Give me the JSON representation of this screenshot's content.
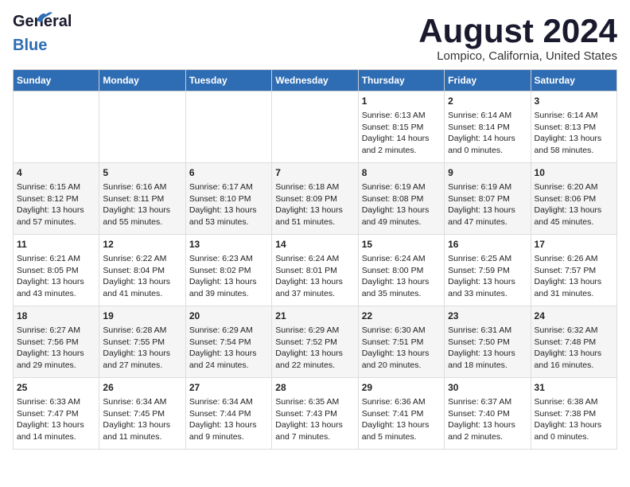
{
  "header": {
    "logo_general": "General",
    "logo_blue": "Blue",
    "title": "August 2024",
    "subtitle": "Lompico, California, United States"
  },
  "days_of_week": [
    "Sunday",
    "Monday",
    "Tuesday",
    "Wednesday",
    "Thursday",
    "Friday",
    "Saturday"
  ],
  "weeks": [
    [
      {
        "day": "",
        "text": ""
      },
      {
        "day": "",
        "text": ""
      },
      {
        "day": "",
        "text": ""
      },
      {
        "day": "",
        "text": ""
      },
      {
        "day": "1",
        "text": "Sunrise: 6:13 AM\nSunset: 8:15 PM\nDaylight: 14 hours\nand 2 minutes."
      },
      {
        "day": "2",
        "text": "Sunrise: 6:14 AM\nSunset: 8:14 PM\nDaylight: 14 hours\nand 0 minutes."
      },
      {
        "day": "3",
        "text": "Sunrise: 6:14 AM\nSunset: 8:13 PM\nDaylight: 13 hours\nand 58 minutes."
      }
    ],
    [
      {
        "day": "4",
        "text": "Sunrise: 6:15 AM\nSunset: 8:12 PM\nDaylight: 13 hours\nand 57 minutes."
      },
      {
        "day": "5",
        "text": "Sunrise: 6:16 AM\nSunset: 8:11 PM\nDaylight: 13 hours\nand 55 minutes."
      },
      {
        "day": "6",
        "text": "Sunrise: 6:17 AM\nSunset: 8:10 PM\nDaylight: 13 hours\nand 53 minutes."
      },
      {
        "day": "7",
        "text": "Sunrise: 6:18 AM\nSunset: 8:09 PM\nDaylight: 13 hours\nand 51 minutes."
      },
      {
        "day": "8",
        "text": "Sunrise: 6:19 AM\nSunset: 8:08 PM\nDaylight: 13 hours\nand 49 minutes."
      },
      {
        "day": "9",
        "text": "Sunrise: 6:19 AM\nSunset: 8:07 PM\nDaylight: 13 hours\nand 47 minutes."
      },
      {
        "day": "10",
        "text": "Sunrise: 6:20 AM\nSunset: 8:06 PM\nDaylight: 13 hours\nand 45 minutes."
      }
    ],
    [
      {
        "day": "11",
        "text": "Sunrise: 6:21 AM\nSunset: 8:05 PM\nDaylight: 13 hours\nand 43 minutes."
      },
      {
        "day": "12",
        "text": "Sunrise: 6:22 AM\nSunset: 8:04 PM\nDaylight: 13 hours\nand 41 minutes."
      },
      {
        "day": "13",
        "text": "Sunrise: 6:23 AM\nSunset: 8:02 PM\nDaylight: 13 hours\nand 39 minutes."
      },
      {
        "day": "14",
        "text": "Sunrise: 6:24 AM\nSunset: 8:01 PM\nDaylight: 13 hours\nand 37 minutes."
      },
      {
        "day": "15",
        "text": "Sunrise: 6:24 AM\nSunset: 8:00 PM\nDaylight: 13 hours\nand 35 minutes."
      },
      {
        "day": "16",
        "text": "Sunrise: 6:25 AM\nSunset: 7:59 PM\nDaylight: 13 hours\nand 33 minutes."
      },
      {
        "day": "17",
        "text": "Sunrise: 6:26 AM\nSunset: 7:57 PM\nDaylight: 13 hours\nand 31 minutes."
      }
    ],
    [
      {
        "day": "18",
        "text": "Sunrise: 6:27 AM\nSunset: 7:56 PM\nDaylight: 13 hours\nand 29 minutes."
      },
      {
        "day": "19",
        "text": "Sunrise: 6:28 AM\nSunset: 7:55 PM\nDaylight: 13 hours\nand 27 minutes."
      },
      {
        "day": "20",
        "text": "Sunrise: 6:29 AM\nSunset: 7:54 PM\nDaylight: 13 hours\nand 24 minutes."
      },
      {
        "day": "21",
        "text": "Sunrise: 6:29 AM\nSunset: 7:52 PM\nDaylight: 13 hours\nand 22 minutes."
      },
      {
        "day": "22",
        "text": "Sunrise: 6:30 AM\nSunset: 7:51 PM\nDaylight: 13 hours\nand 20 minutes."
      },
      {
        "day": "23",
        "text": "Sunrise: 6:31 AM\nSunset: 7:50 PM\nDaylight: 13 hours\nand 18 minutes."
      },
      {
        "day": "24",
        "text": "Sunrise: 6:32 AM\nSunset: 7:48 PM\nDaylight: 13 hours\nand 16 minutes."
      }
    ],
    [
      {
        "day": "25",
        "text": "Sunrise: 6:33 AM\nSunset: 7:47 PM\nDaylight: 13 hours\nand 14 minutes."
      },
      {
        "day": "26",
        "text": "Sunrise: 6:34 AM\nSunset: 7:45 PM\nDaylight: 13 hours\nand 11 minutes."
      },
      {
        "day": "27",
        "text": "Sunrise: 6:34 AM\nSunset: 7:44 PM\nDaylight: 13 hours\nand 9 minutes."
      },
      {
        "day": "28",
        "text": "Sunrise: 6:35 AM\nSunset: 7:43 PM\nDaylight: 13 hours\nand 7 minutes."
      },
      {
        "day": "29",
        "text": "Sunrise: 6:36 AM\nSunset: 7:41 PM\nDaylight: 13 hours\nand 5 minutes."
      },
      {
        "day": "30",
        "text": "Sunrise: 6:37 AM\nSunset: 7:40 PM\nDaylight: 13 hours\nand 2 minutes."
      },
      {
        "day": "31",
        "text": "Sunrise: 6:38 AM\nSunset: 7:38 PM\nDaylight: 13 hours\nand 0 minutes."
      }
    ]
  ]
}
